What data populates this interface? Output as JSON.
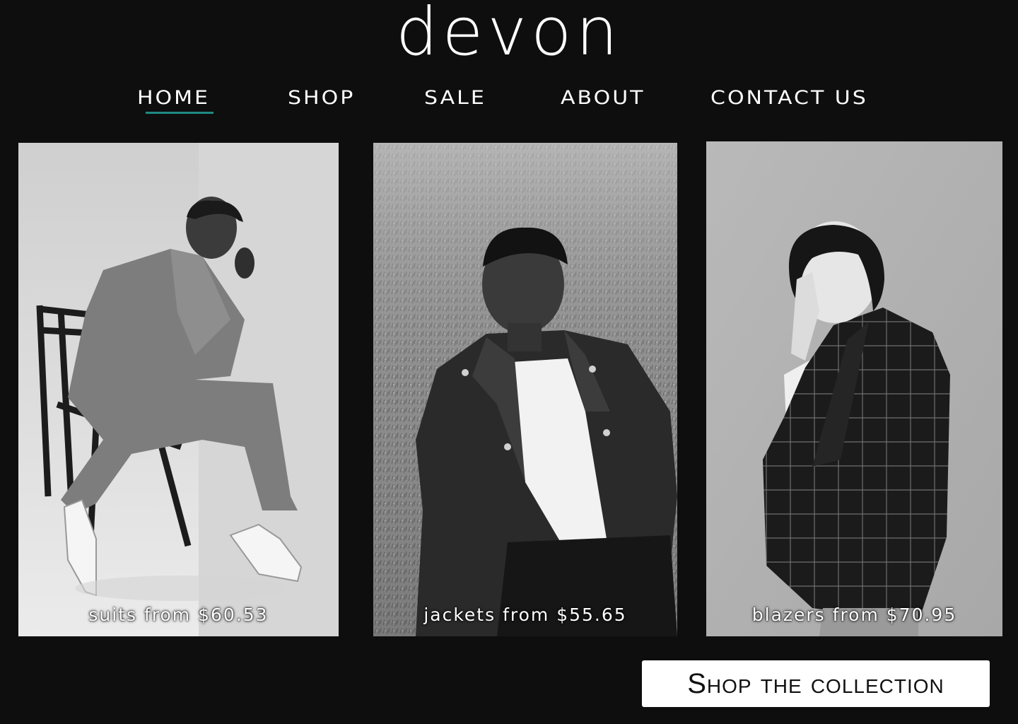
{
  "brand": {
    "logo_text": "Devon"
  },
  "nav": {
    "items": [
      {
        "label": "HOME",
        "active": true
      },
      {
        "label": "SHOP"
      },
      {
        "label": "sale"
      },
      {
        "label": "ABOUT"
      },
      {
        "label": "contact us"
      }
    ],
    "accent_color": "#1f8a84"
  },
  "cards": [
    {
      "caption": "suits from $60.53"
    },
    {
      "caption": "jackets from $55.65"
    },
    {
      "caption": "blazers from $70.95"
    }
  ],
  "cta": {
    "label": "Shop the collection"
  }
}
